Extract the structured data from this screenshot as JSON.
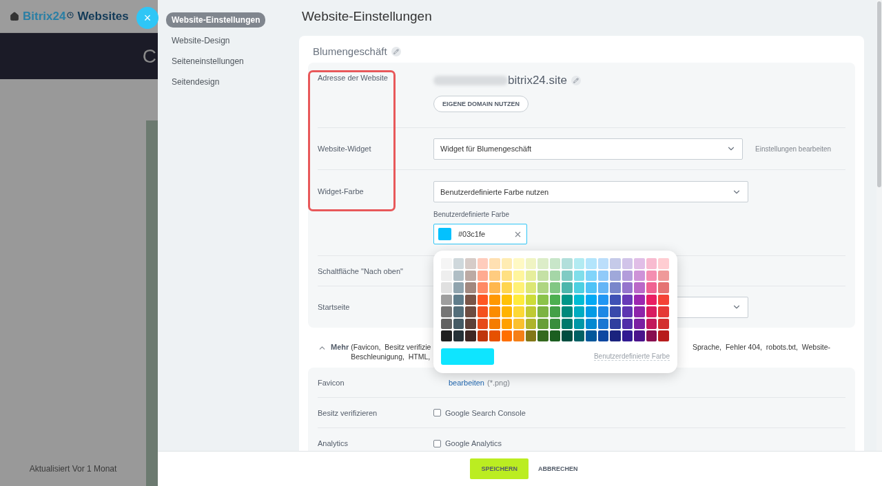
{
  "background_page": {
    "brand": "Bitrix24",
    "product": "Websites",
    "banner_text": "C",
    "updated": "Aktualisiert Vor 1 Monat"
  },
  "close_button": {
    "label": "×"
  },
  "nav": {
    "items": [
      {
        "label": "Website-Einstellungen",
        "selected": true
      },
      {
        "label": "Website-Design",
        "selected": false
      },
      {
        "label": "Seiteneinstellungen",
        "selected": false
      },
      {
        "label": "Seitendesign",
        "selected": false
      }
    ]
  },
  "title": "Website-Einstellungen",
  "site_card": {
    "name": "Blumengeschäft",
    "rows": [
      {
        "kind": "address",
        "label": "Adresse der Website",
        "domain": "bitrix24.site",
        "button": "EIGENE DOMAIN NUTZEN"
      },
      {
        "kind": "select",
        "label": "Website-Widget",
        "value": "Widget für Blumengeschäft",
        "link": "Einstellungen bearbeiten"
      },
      {
        "kind": "color",
        "label": "Widget-Farbe",
        "value": "Benutzerdefinierte Farbe nutzen",
        "sublabel": "Benutzerdefinierte Farbe",
        "color_value": "#03c1fe",
        "color": "#03c1fe"
      },
      {
        "kind": "covered",
        "label": "Schaltfläche \"Nach oben\""
      },
      {
        "kind": "covered_select",
        "label": "Startseite"
      }
    ]
  },
  "more": {
    "label": "Mehr",
    "expanded": true,
    "parts": [
      "(Favicon,  Besitz verifizie",
      "Sprache,  Fehler 404,  robots.txt,  Website-",
      "Beschleunigung,  HTML,"
    ]
  },
  "more_rows": [
    {
      "kind": "link",
      "label": "Favicon",
      "link": "bearbeiten",
      "note": "(*.png)"
    },
    {
      "kind": "checkbox",
      "label": "Besitz verifizieren",
      "option": "Google Search Console",
      "checked": false
    },
    {
      "kind": "checkbox",
      "label": "Analytics",
      "option": "Google Analytics",
      "checked": false
    }
  ],
  "palette": {
    "swatches": [
      [
        {
          "color": "#f5f5f5"
        },
        {
          "color": "#cfd8dc"
        },
        {
          "color": "#d7ccc8"
        },
        {
          "color": "#ffccbc"
        },
        {
          "color": "#ffe0b2"
        },
        {
          "color": "#ffecb3"
        },
        {
          "color": "#fff9c4"
        },
        {
          "color": "#f0f4c3"
        },
        {
          "color": "#dcedc8"
        },
        {
          "color": "#c8e6c9"
        },
        {
          "color": "#b2dfdb"
        },
        {
          "color": "#b2ebf2"
        },
        {
          "color": "#b3e5fc"
        },
        {
          "color": "#bbdefb"
        },
        {
          "color": "#c5cae9"
        },
        {
          "color": "#d1c4e9"
        },
        {
          "color": "#e1bee7"
        },
        {
          "color": "#f8bbd0"
        },
        {
          "color": "#ffcdd2"
        }
      ],
      [
        {
          "color": "#eeeeee"
        },
        {
          "color": "#b0bec5"
        },
        {
          "color": "#bcaaa4"
        },
        {
          "color": "#ffab91"
        },
        {
          "color": "#ffcc80"
        },
        {
          "color": "#ffe082"
        },
        {
          "color": "#fff59d"
        },
        {
          "color": "#e6ee9c"
        },
        {
          "color": "#c5e1a5"
        },
        {
          "color": "#a5d6a7"
        },
        {
          "color": "#80cbc4"
        },
        {
          "color": "#80deea"
        },
        {
          "color": "#81d4fa"
        },
        {
          "color": "#90caf9"
        },
        {
          "color": "#9fa8da"
        },
        {
          "color": "#b39ddb"
        },
        {
          "color": "#ce93d8"
        },
        {
          "color": "#f48fb1"
        },
        {
          "color": "#ef9a9a"
        }
      ],
      [
        {
          "color": "#e0e0e0"
        },
        {
          "color": "#90a4ae"
        },
        {
          "color": "#a1887f"
        },
        {
          "color": "#ff8a65"
        },
        {
          "color": "#ffb74d"
        },
        {
          "color": "#ffd54f"
        },
        {
          "color": "#fff176"
        },
        {
          "color": "#dce775"
        },
        {
          "color": "#aed581"
        },
        {
          "color": "#81c784"
        },
        {
          "color": "#4db6ac"
        },
        {
          "color": "#4dd0e1"
        },
        {
          "color": "#4fc3f7"
        },
        {
          "color": "#64b5f6"
        },
        {
          "color": "#7986cb"
        },
        {
          "color": "#9575cd"
        },
        {
          "color": "#ba68c8"
        },
        {
          "color": "#f06292"
        },
        {
          "color": "#e57373"
        }
      ],
      [
        {
          "color": "#9e9e9e"
        },
        {
          "color": "#607d8b"
        },
        {
          "color": "#795548"
        },
        {
          "color": "#ff5722"
        },
        {
          "color": "#ff9800"
        },
        {
          "color": "#ffc107"
        },
        {
          "color": "#ffeb3b"
        },
        {
          "color": "#cddc39"
        },
        {
          "color": "#8bc34a"
        },
        {
          "color": "#4caf50"
        },
        {
          "color": "#009688"
        },
        {
          "color": "#00bcd4"
        },
        {
          "color": "#03a9f4"
        },
        {
          "color": "#2196f3"
        },
        {
          "color": "#3f51b5"
        },
        {
          "color": "#673ab7"
        },
        {
          "color": "#9c27b0"
        },
        {
          "color": "#e91e63"
        },
        {
          "color": "#f44336"
        }
      ],
      [
        {
          "color": "#757575"
        },
        {
          "color": "#546e7a"
        },
        {
          "color": "#6d4c41"
        },
        {
          "color": "#f4511e"
        },
        {
          "color": "#fb8c00"
        },
        {
          "color": "#ffb300"
        },
        {
          "color": "#fdd835"
        },
        {
          "color": "#c0ca33"
        },
        {
          "color": "#7cb342"
        },
        {
          "color": "#43a047"
        },
        {
          "color": "#00897b"
        },
        {
          "color": "#00acc1"
        },
        {
          "color": "#039be5"
        },
        {
          "color": "#1e88e5"
        },
        {
          "color": "#3949ab"
        },
        {
          "color": "#5e35b1"
        },
        {
          "color": "#8e24aa"
        },
        {
          "color": "#d81b60"
        },
        {
          "color": "#e53935"
        }
      ],
      [
        {
          "color": "#616161"
        },
        {
          "color": "#455a64"
        },
        {
          "color": "#5d4037"
        },
        {
          "color": "#e64a19"
        },
        {
          "color": "#f57c00"
        },
        {
          "color": "#ffa000"
        },
        {
          "color": "#fbc02d"
        },
        {
          "color": "#afb42b"
        },
        {
          "color": "#689f38"
        },
        {
          "color": "#388e3c"
        },
        {
          "color": "#00796b"
        },
        {
          "color": "#0097a7"
        },
        {
          "color": "#0288d1"
        },
        {
          "color": "#1976d2"
        },
        {
          "color": "#303f9f"
        },
        {
          "color": "#512da8"
        },
        {
          "color": "#7b1fa2"
        },
        {
          "color": "#c2185b"
        },
        {
          "color": "#d32f2f"
        }
      ],
      [
        {
          "color": "#212121"
        },
        {
          "color": "#263238"
        },
        {
          "color": "#3e2723"
        },
        {
          "color": "#bf360c"
        },
        {
          "color": "#e65100"
        },
        {
          "color": "#ff6f00"
        },
        {
          "color": "#f57f17"
        },
        {
          "color": "#827717"
        },
        {
          "color": "#33691e"
        },
        {
          "color": "#1b5e20"
        },
        {
          "color": "#004d40"
        },
        {
          "color": "#006064"
        },
        {
          "color": "#01579b"
        },
        {
          "color": "#0d47a1"
        },
        {
          "color": "#1a237e"
        },
        {
          "color": "#311b92"
        },
        {
          "color": "#4a148c"
        },
        {
          "color": "#880e4f"
        },
        {
          "color": "#b71c1c"
        }
      ]
    ],
    "preview": {
      "color": "#0ee5ff"
    },
    "custom_link": "Benutzerdefinierte Farbe"
  },
  "footer": {
    "save": "SPEICHERN",
    "cancel": "ABBRECHEN"
  }
}
